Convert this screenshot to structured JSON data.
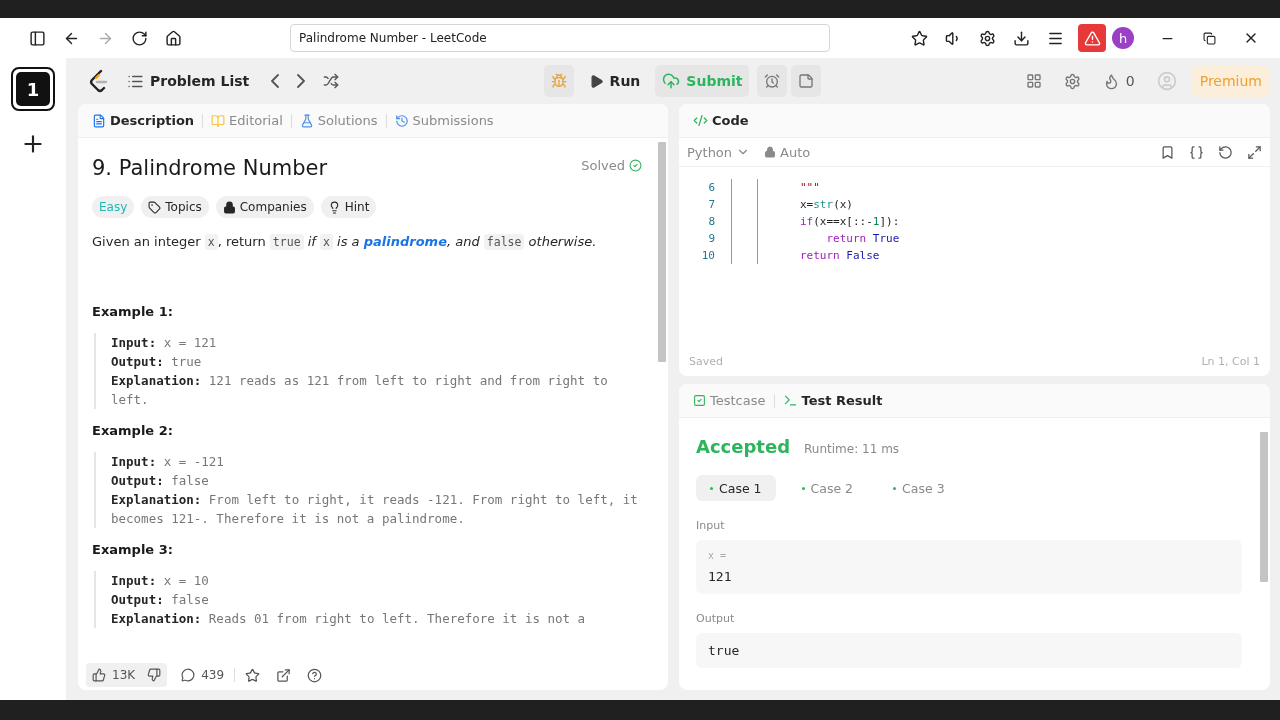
{
  "browser": {
    "address": "Palindrome Number - LeetCode",
    "profile_initial": "h"
  },
  "side_strip": {
    "workspace": "1"
  },
  "toolbar": {
    "problem_list": "Problem List",
    "run": "Run",
    "submit": "Submit",
    "streak": "0",
    "premium": "Premium"
  },
  "description_panel": {
    "tabs": [
      {
        "label": "Description",
        "selected": true
      },
      {
        "label": "Editorial",
        "selected": false
      },
      {
        "label": "Solutions",
        "selected": false
      },
      {
        "label": "Submissions",
        "selected": false
      }
    ],
    "title": "9. Palindrome Number",
    "status": "Solved",
    "tags": [
      {
        "label": "Easy",
        "kind": "difficulty"
      },
      {
        "label": "Topics",
        "kind": "topics"
      },
      {
        "label": "Companies",
        "kind": "companies"
      },
      {
        "label": "Hint",
        "kind": "hint"
      }
    ],
    "description": [
      {
        "text": "Given an integer ",
        "kind": "plain"
      },
      {
        "text": "x",
        "kind": "code"
      },
      {
        "text": ", return ",
        "kind": "plain"
      },
      {
        "text": "true",
        "kind": "code"
      },
      {
        "text": " if ",
        "kind": "italic"
      },
      {
        "text": "x",
        "kind": "code"
      },
      {
        "text": " is a ",
        "kind": "italic"
      },
      {
        "text": "palindrome",
        "kind": "link"
      },
      {
        "text": ", and ",
        "kind": "italic"
      },
      {
        "text": "false",
        "kind": "code"
      },
      {
        "text": " otherwise.",
        "kind": "italic"
      }
    ],
    "examples": [
      {
        "title": "Example 1:",
        "lines": [
          {
            "label": "Input:",
            "value": "x = 121"
          },
          {
            "label": "Output:",
            "value": "true"
          },
          {
            "label": "Explanation:",
            "value": "121 reads as 121 from left to right and from right to left."
          }
        ]
      },
      {
        "title": "Example 2:",
        "lines": [
          {
            "label": "Input:",
            "value": "x = -121"
          },
          {
            "label": "Output:",
            "value": "false"
          },
          {
            "label": "Explanation:",
            "value": "From left to right, it reads -121. From right to left, it becomes 121-. Therefore it is not a palindrome."
          }
        ]
      },
      {
        "title": "Example 3:",
        "lines": [
          {
            "label": "Input:",
            "value": "x = 10"
          },
          {
            "label": "Output:",
            "value": "false"
          },
          {
            "label": "Explanation:",
            "value": "Reads 01 from right to left. Therefore it is not a"
          }
        ]
      }
    ],
    "footer": {
      "likes": "13K",
      "comments": "439"
    }
  },
  "code_panel": {
    "title": "Code",
    "language": "Python",
    "mode": "Auto",
    "lines": [
      {
        "number": "6",
        "tokens": [
          {
            "text": "\"\"\"",
            "kind": "string"
          }
        ]
      },
      {
        "number": "7",
        "tokens": [
          {
            "text": "x=",
            "kind": "plain"
          },
          {
            "text": "str",
            "kind": "builtin"
          },
          {
            "text": "(x)",
            "kind": "plain"
          }
        ]
      },
      {
        "number": "8",
        "tokens": [
          {
            "text": "if",
            "kind": "keyword"
          },
          {
            "text": "(x==x[::-",
            "kind": "plain"
          },
          {
            "text": "1",
            "kind": "number"
          },
          {
            "text": "]):",
            "kind": "plain"
          }
        ]
      },
      {
        "number": "9",
        "tokens": [
          {
            "text": "    return",
            "kind": "keyword"
          },
          {
            "text": " True",
            "kind": "constant"
          }
        ]
      },
      {
        "number": "10",
        "tokens": [
          {
            "text": "return",
            "kind": "keyword"
          },
          {
            "text": " False",
            "kind": "constant"
          }
        ]
      }
    ],
    "saved": "Saved",
    "cursor": "Ln 1, Col 1"
  },
  "result_panel": {
    "tabs": [
      {
        "label": "Testcase",
        "selected": false
      },
      {
        "label": "Test Result",
        "selected": true
      }
    ],
    "verdict": "Accepted",
    "runtime": "Runtime: 11 ms",
    "cases": [
      {
        "label": "Case 1",
        "selected": true
      },
      {
        "label": "Case 2",
        "selected": false
      },
      {
        "label": "Case 3",
        "selected": false
      }
    ],
    "input_label": "Input",
    "input_var": "x =",
    "input_value": "121",
    "output_label": "Output",
    "output_value": "true"
  }
}
